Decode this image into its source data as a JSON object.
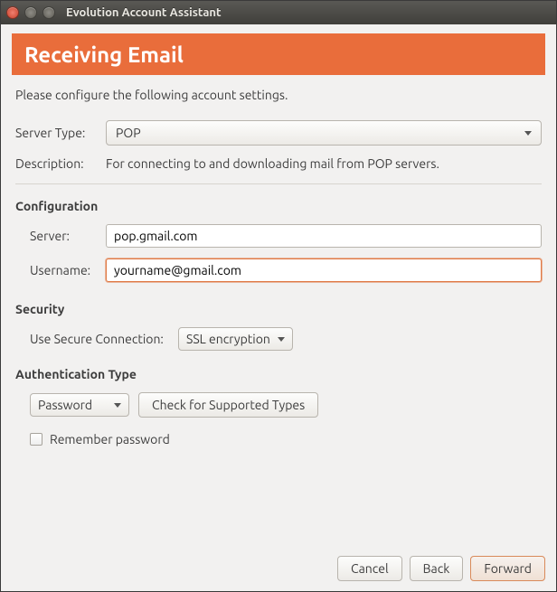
{
  "window": {
    "title": "Evolution Account Assistant"
  },
  "header": {
    "title": "Receiving Email"
  },
  "intro": "Please configure the following account settings.",
  "server_type": {
    "label": "Server Type:",
    "value": "POP",
    "description_label": "Description:",
    "description": "For connecting to and downloading mail from POP servers."
  },
  "configuration": {
    "title": "Configuration",
    "server_label": "Server:",
    "server_value": "pop.gmail.com",
    "username_label": "Username:",
    "username_value": "yourname@gmail.com"
  },
  "security": {
    "title": "Security",
    "conn_label": "Use Secure Connection:",
    "conn_value": "SSL encryption"
  },
  "auth": {
    "title": "Authentication Type",
    "type_value": "Password",
    "check_label": "Check for Supported Types",
    "remember_label": "Remember password"
  },
  "buttons": {
    "cancel": "Cancel",
    "back": "Back",
    "forward": "Forward"
  }
}
